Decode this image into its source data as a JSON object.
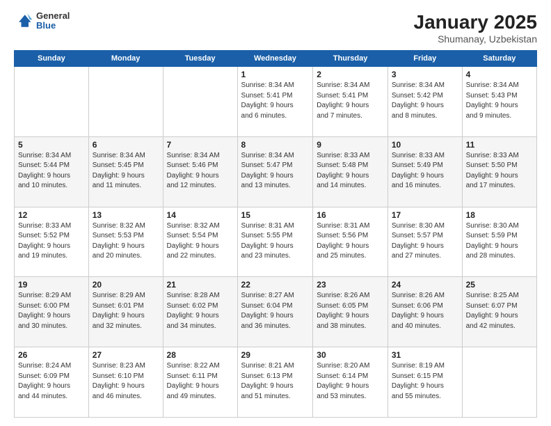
{
  "header": {
    "logo": {
      "line1": "General",
      "line2": "Blue"
    },
    "title": "January 2025",
    "location": "Shumanay, Uzbekistan"
  },
  "weekdays": [
    "Sunday",
    "Monday",
    "Tuesday",
    "Wednesday",
    "Thursday",
    "Friday",
    "Saturday"
  ],
  "weeks": [
    [
      {
        "day": "",
        "info": ""
      },
      {
        "day": "",
        "info": ""
      },
      {
        "day": "",
        "info": ""
      },
      {
        "day": "1",
        "info": "Sunrise: 8:34 AM\nSunset: 5:41 PM\nDaylight: 9 hours\nand 6 minutes."
      },
      {
        "day": "2",
        "info": "Sunrise: 8:34 AM\nSunset: 5:41 PM\nDaylight: 9 hours\nand 7 minutes."
      },
      {
        "day": "3",
        "info": "Sunrise: 8:34 AM\nSunset: 5:42 PM\nDaylight: 9 hours\nand 8 minutes."
      },
      {
        "day": "4",
        "info": "Sunrise: 8:34 AM\nSunset: 5:43 PM\nDaylight: 9 hours\nand 9 minutes."
      }
    ],
    [
      {
        "day": "5",
        "info": "Sunrise: 8:34 AM\nSunset: 5:44 PM\nDaylight: 9 hours\nand 10 minutes."
      },
      {
        "day": "6",
        "info": "Sunrise: 8:34 AM\nSunset: 5:45 PM\nDaylight: 9 hours\nand 11 minutes."
      },
      {
        "day": "7",
        "info": "Sunrise: 8:34 AM\nSunset: 5:46 PM\nDaylight: 9 hours\nand 12 minutes."
      },
      {
        "day": "8",
        "info": "Sunrise: 8:34 AM\nSunset: 5:47 PM\nDaylight: 9 hours\nand 13 minutes."
      },
      {
        "day": "9",
        "info": "Sunrise: 8:33 AM\nSunset: 5:48 PM\nDaylight: 9 hours\nand 14 minutes."
      },
      {
        "day": "10",
        "info": "Sunrise: 8:33 AM\nSunset: 5:49 PM\nDaylight: 9 hours\nand 16 minutes."
      },
      {
        "day": "11",
        "info": "Sunrise: 8:33 AM\nSunset: 5:50 PM\nDaylight: 9 hours\nand 17 minutes."
      }
    ],
    [
      {
        "day": "12",
        "info": "Sunrise: 8:33 AM\nSunset: 5:52 PM\nDaylight: 9 hours\nand 19 minutes."
      },
      {
        "day": "13",
        "info": "Sunrise: 8:32 AM\nSunset: 5:53 PM\nDaylight: 9 hours\nand 20 minutes."
      },
      {
        "day": "14",
        "info": "Sunrise: 8:32 AM\nSunset: 5:54 PM\nDaylight: 9 hours\nand 22 minutes."
      },
      {
        "day": "15",
        "info": "Sunrise: 8:31 AM\nSunset: 5:55 PM\nDaylight: 9 hours\nand 23 minutes."
      },
      {
        "day": "16",
        "info": "Sunrise: 8:31 AM\nSunset: 5:56 PM\nDaylight: 9 hours\nand 25 minutes."
      },
      {
        "day": "17",
        "info": "Sunrise: 8:30 AM\nSunset: 5:57 PM\nDaylight: 9 hours\nand 27 minutes."
      },
      {
        "day": "18",
        "info": "Sunrise: 8:30 AM\nSunset: 5:59 PM\nDaylight: 9 hours\nand 28 minutes."
      }
    ],
    [
      {
        "day": "19",
        "info": "Sunrise: 8:29 AM\nSunset: 6:00 PM\nDaylight: 9 hours\nand 30 minutes."
      },
      {
        "day": "20",
        "info": "Sunrise: 8:29 AM\nSunset: 6:01 PM\nDaylight: 9 hours\nand 32 minutes."
      },
      {
        "day": "21",
        "info": "Sunrise: 8:28 AM\nSunset: 6:02 PM\nDaylight: 9 hours\nand 34 minutes."
      },
      {
        "day": "22",
        "info": "Sunrise: 8:27 AM\nSunset: 6:04 PM\nDaylight: 9 hours\nand 36 minutes."
      },
      {
        "day": "23",
        "info": "Sunrise: 8:26 AM\nSunset: 6:05 PM\nDaylight: 9 hours\nand 38 minutes."
      },
      {
        "day": "24",
        "info": "Sunrise: 8:26 AM\nSunset: 6:06 PM\nDaylight: 9 hours\nand 40 minutes."
      },
      {
        "day": "25",
        "info": "Sunrise: 8:25 AM\nSunset: 6:07 PM\nDaylight: 9 hours\nand 42 minutes."
      }
    ],
    [
      {
        "day": "26",
        "info": "Sunrise: 8:24 AM\nSunset: 6:09 PM\nDaylight: 9 hours\nand 44 minutes."
      },
      {
        "day": "27",
        "info": "Sunrise: 8:23 AM\nSunset: 6:10 PM\nDaylight: 9 hours\nand 46 minutes."
      },
      {
        "day": "28",
        "info": "Sunrise: 8:22 AM\nSunset: 6:11 PM\nDaylight: 9 hours\nand 49 minutes."
      },
      {
        "day": "29",
        "info": "Sunrise: 8:21 AM\nSunset: 6:13 PM\nDaylight: 9 hours\nand 51 minutes."
      },
      {
        "day": "30",
        "info": "Sunrise: 8:20 AM\nSunset: 6:14 PM\nDaylight: 9 hours\nand 53 minutes."
      },
      {
        "day": "31",
        "info": "Sunrise: 8:19 AM\nSunset: 6:15 PM\nDaylight: 9 hours\nand 55 minutes."
      },
      {
        "day": "",
        "info": ""
      }
    ]
  ]
}
